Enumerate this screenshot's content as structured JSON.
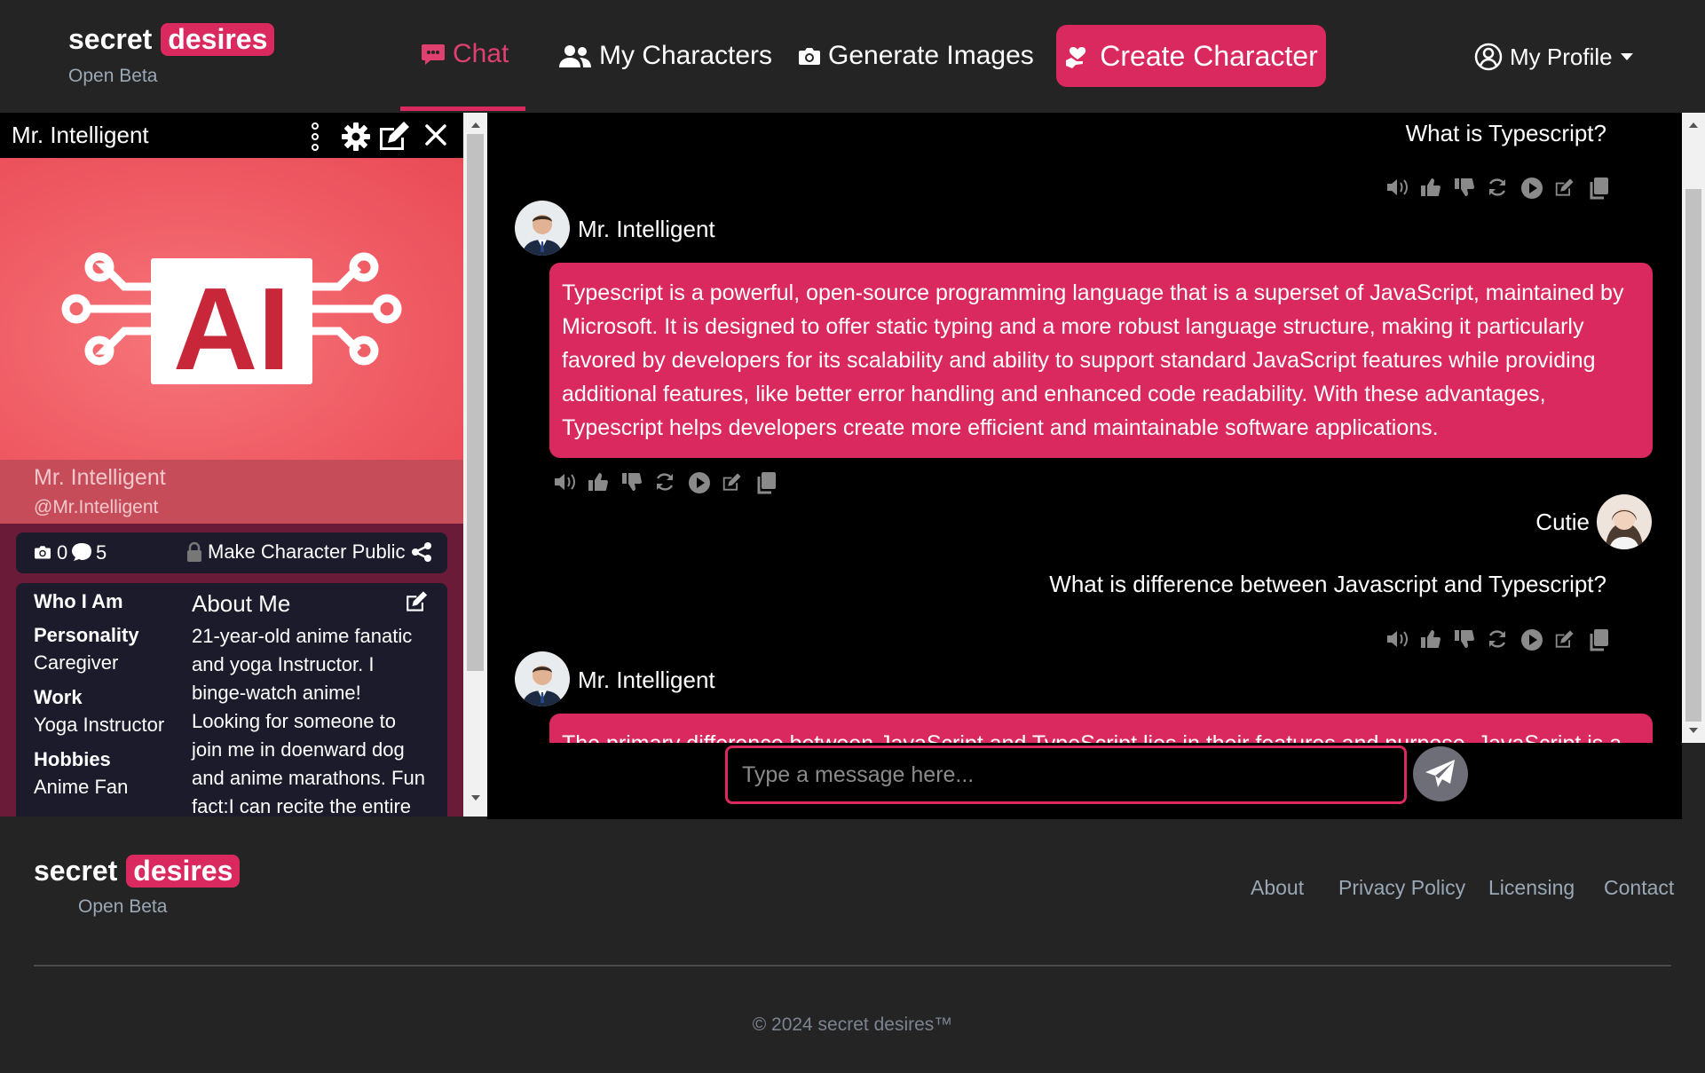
{
  "nav": {
    "brand_word1": "secret",
    "brand_word2": "desires",
    "beta": "Open Beta",
    "chat": "Chat",
    "my_characters": "My Characters",
    "generate_images": "Generate Images",
    "create_character": "Create Character",
    "my_profile": "My Profile"
  },
  "character": {
    "header_title": "Mr. Intelligent",
    "banner_text": "AI",
    "name": "Mr. Intelligent",
    "handle": "@Mr.Intelligent",
    "image_count": "0",
    "message_count": "5",
    "make_public": "Make Character Public",
    "who_i_am": "Who I Am",
    "personality_label": "Personality",
    "personality_value": "Caregiver",
    "work_label": "Work",
    "work_value": "Yoga Instructor",
    "hobbies_label": "Hobbies",
    "hobbies_value": "Anime Fan",
    "about_title": "About Me",
    "about_lines": [
      "21-year-old anime fanatic",
      "and yoga Instructor. I",
      "binge-watch anime!",
      "Looking for someone to",
      "join me in doenward dog",
      "and anime marathons. Fun",
      "fact:I can recite the entire"
    ]
  },
  "chat": {
    "messages": [
      {
        "sender": "",
        "text": "What is Typescript?"
      },
      {
        "sender": "Mr. Intelligent",
        "text": "Typescript is a powerful, open-source programming language that is a superset of JavaScript, maintained by Microsoft. It is designed to offer static typing and a more robust language structure, making it particularly favored by developers for its scalability and ability to support standard JavaScript features while providing additional features, like better error handling and enhanced code readability. With these advantages, Typescript helps developers create more efficient and maintainable software applications."
      },
      {
        "sender": "Cutie",
        "text": "What is difference between Javascript and Typescript?"
      },
      {
        "sender": "Mr. Intelligent",
        "text": "The primary difference between JavaScript and TypeScript lies in their features and purpose. JavaScript is a"
      }
    ],
    "input_placeholder": "Type a message here..."
  },
  "footer": {
    "brand_word1": "secret",
    "brand_word2": "desires",
    "beta": "Open Beta",
    "links": [
      "About",
      "Privacy Policy",
      "Licensing",
      "Contact"
    ],
    "copyright": "© 2024 secret desires™"
  },
  "colors": {
    "accent": "#d9295f",
    "background": "#242424",
    "chat_bg": "#000000",
    "muted": "#9aa8b6"
  }
}
